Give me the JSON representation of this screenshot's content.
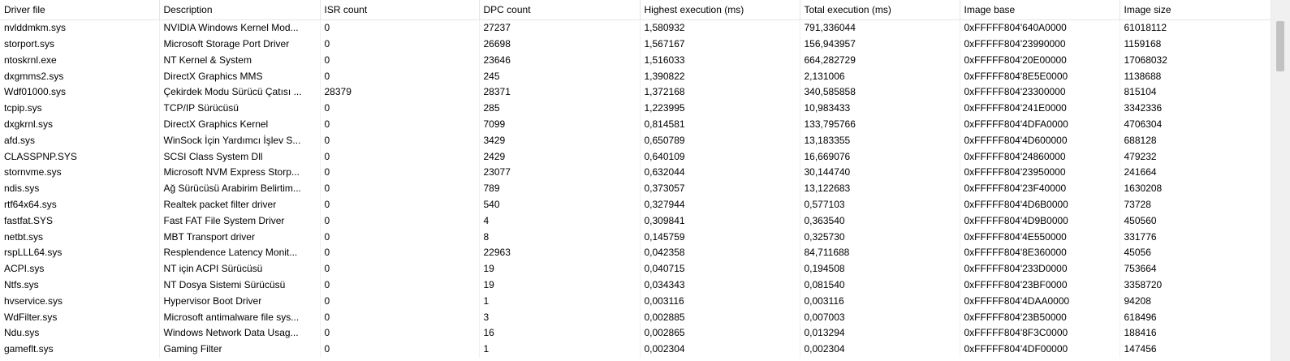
{
  "columns": [
    "Driver file",
    "Description",
    "ISR count",
    "DPC count",
    "Highest execution (ms)",
    "Total execution (ms)",
    "Image base",
    "Image size"
  ],
  "rows": [
    [
      "nvlddmkm.sys",
      "NVIDIA Windows Kernel Mod...",
      "0",
      "27237",
      "1,580932",
      "791,336044",
      "0xFFFFF804'640A0000",
      "61018112"
    ],
    [
      "storport.sys",
      "Microsoft Storage Port Driver",
      "0",
      "26698",
      "1,567167",
      "156,943957",
      "0xFFFFF804'23990000",
      "1159168"
    ],
    [
      "ntoskrnl.exe",
      "NT Kernel & System",
      "0",
      "23646",
      "1,516033",
      "664,282729",
      "0xFFFFF804'20E00000",
      "17068032"
    ],
    [
      "dxgmms2.sys",
      "DirectX Graphics MMS",
      "0",
      "245",
      "1,390822",
      "2,131006",
      "0xFFFFF804'8E5E0000",
      "1138688"
    ],
    [
      "Wdf01000.sys",
      "Çekirdek Modu Sürücü Çatısı ...",
      "28379",
      "28371",
      "1,372168",
      "340,585858",
      "0xFFFFF804'23300000",
      "815104"
    ],
    [
      "tcpip.sys",
      "TCP/IP Sürücüsü",
      "0",
      "285",
      "1,223995",
      "10,983433",
      "0xFFFFF804'241E0000",
      "3342336"
    ],
    [
      "dxgkrnl.sys",
      "DirectX Graphics Kernel",
      "0",
      "7099",
      "0,814581",
      "133,795766",
      "0xFFFFF804'4DFA0000",
      "4706304"
    ],
    [
      "afd.sys",
      "WinSock İçin Yardımcı İşlev S...",
      "0",
      "3429",
      "0,650789",
      "13,183355",
      "0xFFFFF804'4D600000",
      "688128"
    ],
    [
      "CLASSPNP.SYS",
      "SCSI Class System Dll",
      "0",
      "2429",
      "0,640109",
      "16,669076",
      "0xFFFFF804'24860000",
      "479232"
    ],
    [
      "stornvme.sys",
      "Microsoft NVM Express Storp...",
      "0",
      "23077",
      "0,632044",
      "30,144740",
      "0xFFFFF804'23950000",
      "241664"
    ],
    [
      "ndis.sys",
      "Ağ Sürücüsü Arabirim Belirtim...",
      "0",
      "789",
      "0,373057",
      "13,122683",
      "0xFFFFF804'23F40000",
      "1630208"
    ],
    [
      "rtf64x64.sys",
      "Realtek packet filter driver",
      "0",
      "540",
      "0,327944",
      "0,577103",
      "0xFFFFF804'4D6B0000",
      "73728"
    ],
    [
      "fastfat.SYS",
      "Fast FAT File System Driver",
      "0",
      "4",
      "0,309841",
      "0,363540",
      "0xFFFFF804'4D9B0000",
      "450560"
    ],
    [
      "netbt.sys",
      "MBT Transport driver",
      "0",
      "8",
      "0,145759",
      "0,325730",
      "0xFFFFF804'4E550000",
      "331776"
    ],
    [
      "rspLLL64.sys",
      "Resplendence Latency Monit...",
      "0",
      "22963",
      "0,042358",
      "84,711688",
      "0xFFFFF804'8E360000",
      "45056"
    ],
    [
      "ACPI.sys",
      "NT için ACPI Sürücüsü",
      "0",
      "19",
      "0,040715",
      "0,194508",
      "0xFFFFF804'233D0000",
      "753664"
    ],
    [
      "Ntfs.sys",
      "NT Dosya Sistemi Sürücüsü",
      "0",
      "19",
      "0,034343",
      "0,081540",
      "0xFFFFF804'23BF0000",
      "3358720"
    ],
    [
      "hvservice.sys",
      "Hypervisor Boot Driver",
      "0",
      "1",
      "0,003116",
      "0,003116",
      "0xFFFFF804'4DAA0000",
      "94208"
    ],
    [
      "WdFilter.sys",
      "Microsoft antimalware file sys...",
      "0",
      "3",
      "0,002885",
      "0,007003",
      "0xFFFFF804'23B50000",
      "618496"
    ],
    [
      "Ndu.sys",
      "Windows Network Data Usag...",
      "0",
      "16",
      "0,002865",
      "0,013294",
      "0xFFFFF804'8F3C0000",
      "188416"
    ],
    [
      "gameflt.sys",
      "Gaming Filter",
      "0",
      "1",
      "0,002304",
      "0,002304",
      "0xFFFFF804'4DF00000",
      "147456"
    ]
  ]
}
